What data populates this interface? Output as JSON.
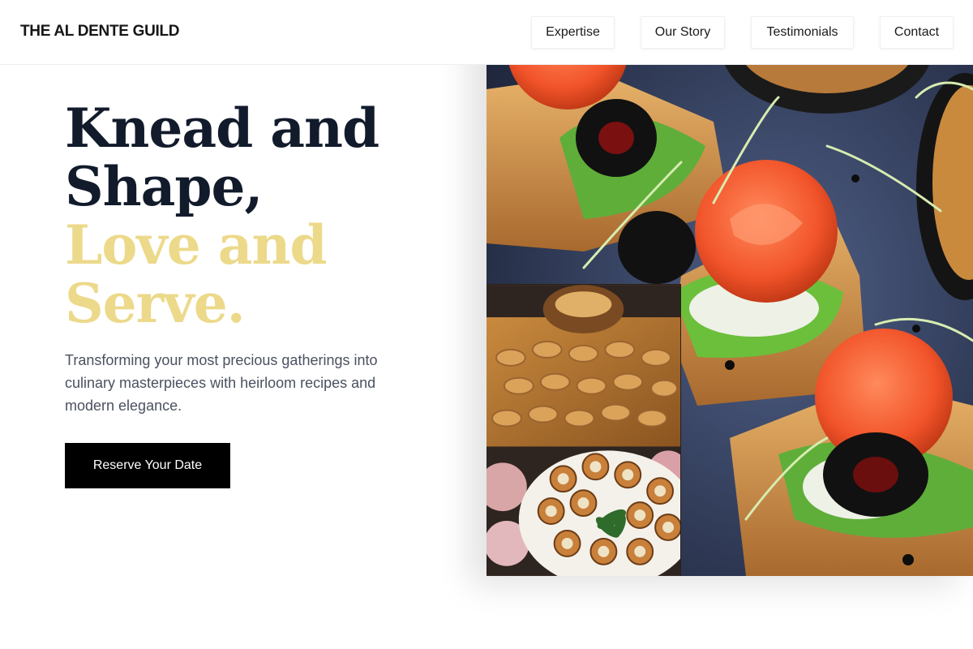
{
  "brand": {
    "name": "THE AL DENTE GUILD"
  },
  "nav": {
    "items": [
      {
        "label": "Expertise"
      },
      {
        "label": "Our Story"
      },
      {
        "label": "Testimonials"
      },
      {
        "label": "Contact"
      }
    ]
  },
  "hero": {
    "title_line1": "Knead and",
    "title_line2": "Shape,",
    "title_line3": "Love and",
    "title_line4": "Serve.",
    "subtitle": "Transforming your most precious gatherings into culinary masterpieces with heirloom recipes and modern elegance.",
    "cta_label": "Reserve Your Date"
  },
  "images": {
    "main": "salmon-rose-canapes-on-toast",
    "secondary": "mini-croissants-and-tartlets-platter"
  },
  "colors": {
    "title_dark": "#121b2b",
    "title_accent": "#ecd98a",
    "cta_bg": "#000000"
  }
}
